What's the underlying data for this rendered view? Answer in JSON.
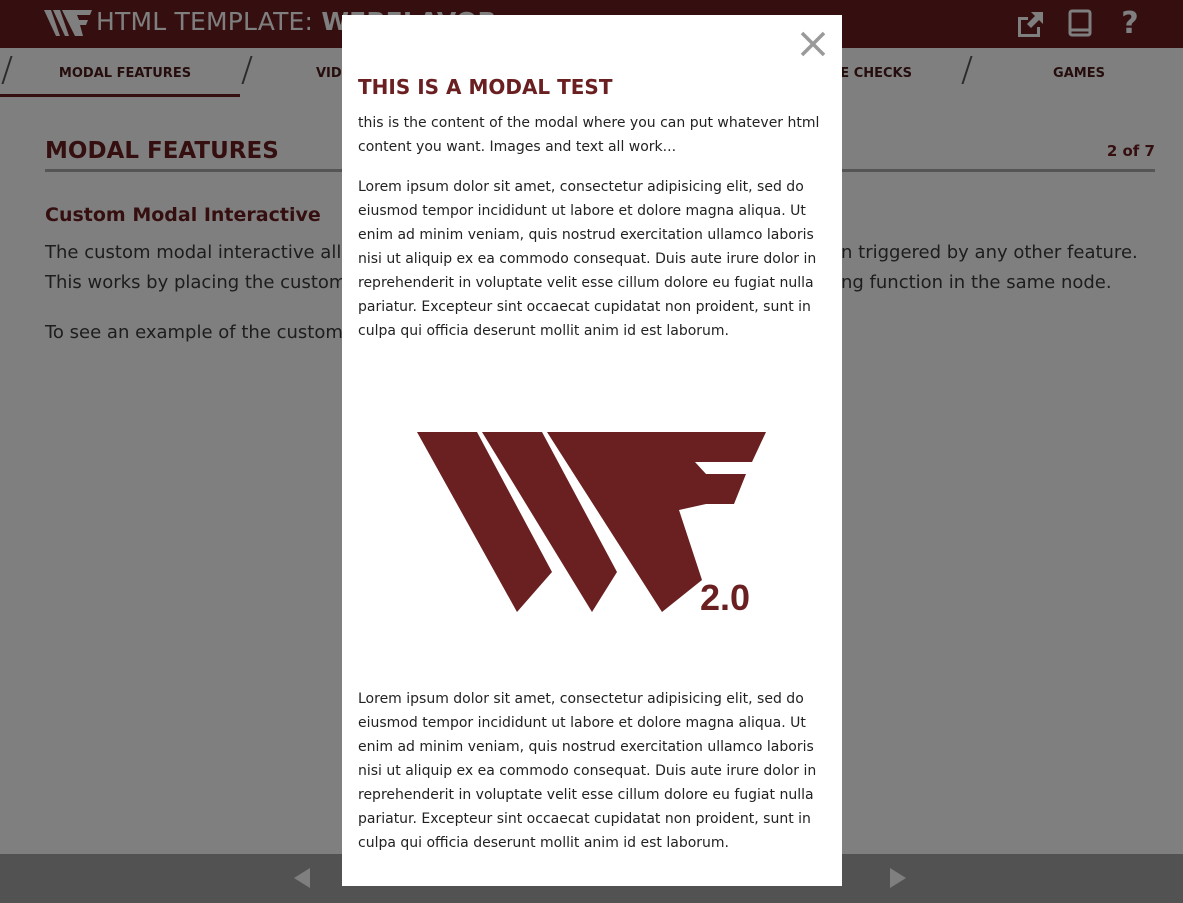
{
  "header": {
    "title_prefix": "HTML TEMPLATE: ",
    "app_name": "WEBFLAVOR",
    "help_glyph": "?",
    "icons": [
      "wf-logo-icon",
      "external-link-icon",
      "book-icon",
      "help-icon"
    ]
  },
  "tabs": [
    {
      "label": "MODAL FEATURES",
      "active": true
    },
    {
      "label": "VIDE"
    },
    {
      "label": "GE CHECKS"
    },
    {
      "label": "GAMES"
    }
  ],
  "content": {
    "page_title": "MODAL FEATURES",
    "page_counter": "2 of 7",
    "section_title": "Custom Modal Interactive",
    "section_text": "The custom modal interactive allo… triggered by any other feature. This works by placing the custom … function in the same node.",
    "section_text_line1_start": "The custom modal interactive allov",
    "section_text_line1_end": "n triggered by any other feature.",
    "section_text_line2_start": "This works by placing the custom h",
    "section_text_line2_end": "ng function in the same node.",
    "section_text2": "To see an example of the custom ir"
  },
  "modal": {
    "title": "THIS IS A MODAL TEST",
    "intro": "this is the content of the modal where you can put whatever html content you want. Images and text all work...",
    "paragraph1": "Lorem ipsum dolor sit amet, consectetur adipisicing elit, sed do eiusmod tempor incididunt ut labore et dolore magna aliqua. Ut enim ad minim veniam, quis nostrud exercitation ullamco laboris nisi ut aliquip ex ea commodo consequat. Duis aute irure dolor in reprehenderit in voluptate velit esse cillum dolore eu fugiat nulla pariatur. Excepteur sint occaecat cupidatat non proident, sunt in culpa qui officia deserunt mollit anim id est laborum.",
    "image_version": "2.0",
    "paragraph2": "Lorem ipsum dolor sit amet, consectetur adipisicing elit, sed do eiusmod tempor incididunt ut labore et dolore magna aliqua. Ut enim ad minim veniam, quis nostrud exercitation ullamco laboris nisi ut aliquip ex ea commodo consequat. Duis aute irure dolor in reprehenderit in voluptate velit esse cillum dolore eu fugiat nulla pariatur. Excepteur sint occaecat cupidatat non proident, sunt in culpa qui officia deserunt mollit anim id est laborum.",
    "icons": [
      "close-icon"
    ]
  },
  "footer": {
    "icons": [
      "prev-arrow-icon",
      "pause-icon",
      "next-arrow-icon"
    ]
  },
  "colors": {
    "brand": "#6a1f21",
    "overlay": "rgba(0,0,0,0.5)",
    "footer": "#a5a5a5"
  }
}
